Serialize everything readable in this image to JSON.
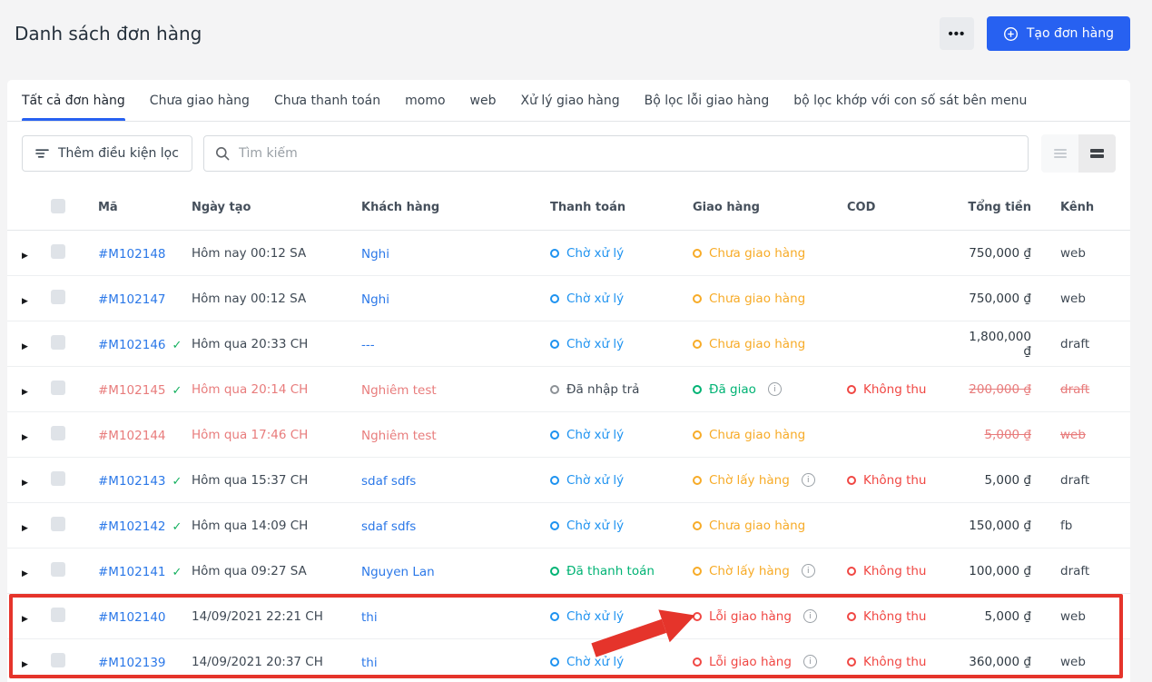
{
  "page": {
    "title": "Danh sách đơn hàng"
  },
  "actions": {
    "more_label": "•••",
    "create_label": "Tạo đơn hàng"
  },
  "tabs": [
    {
      "label": "Tất cả đơn hàng",
      "active": true
    },
    {
      "label": "Chưa giao hàng",
      "active": false
    },
    {
      "label": "Chưa thanh toán",
      "active": false
    },
    {
      "label": "momo",
      "active": false
    },
    {
      "label": "web",
      "active": false
    },
    {
      "label": "Xử lý giao hàng",
      "active": false
    },
    {
      "label": "Bộ lọc lỗi giao hàng",
      "active": false
    },
    {
      "label": "bộ lọc khớp với con số sát bên menu",
      "active": false
    }
  ],
  "filter": {
    "add_filter_label": "Thêm điều kiện lọc",
    "search_placeholder": "Tìm kiếm"
  },
  "table": {
    "columns": [
      "Mã",
      "Ngày tạo",
      "Khách hàng",
      "Thanh toán",
      "Giao hàng",
      "COD",
      "Tổng tiền",
      "Kênh"
    ],
    "currency": "₫",
    "rows": [
      {
        "code": "#M102148",
        "verified": false,
        "created": "Hôm nay 00:12 SA",
        "customer": "Nghi",
        "payment": {
          "label": "Chờ xử lý",
          "color": "blue"
        },
        "shipping": {
          "label": "Chưa giao hàng",
          "color": "orange",
          "info": false
        },
        "cod": null,
        "total": "750,000",
        "channel": "web",
        "muted": false,
        "total_struck": false,
        "channel_struck": false,
        "highlighted": false
      },
      {
        "code": "#M102147",
        "verified": false,
        "created": "Hôm nay 00:12 SA",
        "customer": "Nghi",
        "payment": {
          "label": "Chờ xử lý",
          "color": "blue"
        },
        "shipping": {
          "label": "Chưa giao hàng",
          "color": "orange",
          "info": false
        },
        "cod": null,
        "total": "750,000",
        "channel": "web",
        "muted": false,
        "total_struck": false,
        "channel_struck": false,
        "highlighted": false
      },
      {
        "code": "#M102146",
        "verified": true,
        "created": "Hôm qua 20:33 CH",
        "customer": "---",
        "payment": {
          "label": "Chờ xử lý",
          "color": "blue"
        },
        "shipping": {
          "label": "Chưa giao hàng",
          "color": "orange",
          "info": false
        },
        "cod": null,
        "total": "1,800,000",
        "channel": "draft",
        "muted": false,
        "total_struck": false,
        "channel_struck": false,
        "highlighted": false
      },
      {
        "code": "#M102145",
        "verified": true,
        "created": "Hôm qua 20:14 CH",
        "customer": "Nghiêm test",
        "payment": {
          "label": "Đã nhập trả",
          "color": "gray"
        },
        "shipping": {
          "label": "Đã giao",
          "color": "green",
          "info": true
        },
        "cod": {
          "label": "Không thu",
          "color": "red"
        },
        "total": "200,000",
        "channel": "draft",
        "muted": true,
        "total_struck": true,
        "channel_struck": true,
        "highlighted": false
      },
      {
        "code": "#M102144",
        "verified": false,
        "created": "Hôm qua 17:46 CH",
        "customer": "Nghiêm test",
        "payment": {
          "label": "Chờ xử lý",
          "color": "blue"
        },
        "shipping": {
          "label": "Chưa giao hàng",
          "color": "orange",
          "info": false
        },
        "cod": null,
        "total": "5,000",
        "channel": "web",
        "muted": true,
        "total_struck": true,
        "channel_struck": true,
        "highlighted": false
      },
      {
        "code": "#M102143",
        "verified": true,
        "created": "Hôm qua 15:37 CH",
        "customer": "sdaf sdfs",
        "payment": {
          "label": "Chờ xử lý",
          "color": "blue"
        },
        "shipping": {
          "label": "Chờ lấy hàng",
          "color": "orange",
          "info": true
        },
        "cod": {
          "label": "Không thu",
          "color": "red"
        },
        "total": "5,000",
        "channel": "draft",
        "muted": false,
        "total_struck": false,
        "channel_struck": false,
        "highlighted": false
      },
      {
        "code": "#M102142",
        "verified": true,
        "created": "Hôm qua 14:09 CH",
        "customer": "sdaf sdfs",
        "payment": {
          "label": "Chờ xử lý",
          "color": "blue"
        },
        "shipping": {
          "label": "Chưa giao hàng",
          "color": "orange",
          "info": false
        },
        "cod": null,
        "total": "150,000",
        "channel": "fb",
        "muted": false,
        "total_struck": false,
        "channel_struck": false,
        "highlighted": false
      },
      {
        "code": "#M102141",
        "verified": true,
        "created": "Hôm qua 09:27 SA",
        "customer": "Nguyen Lan",
        "payment": {
          "label": "Đã thanh toán",
          "color": "green"
        },
        "shipping": {
          "label": "Chờ lấy hàng",
          "color": "orange",
          "info": true
        },
        "cod": {
          "label": "Không thu",
          "color": "red"
        },
        "total": "100,000",
        "channel": "draft",
        "muted": false,
        "total_struck": false,
        "channel_struck": false,
        "highlighted": false
      },
      {
        "code": "#M102140",
        "verified": false,
        "created": "14/09/2021 22:21 CH",
        "customer": "thi",
        "payment": {
          "label": "Chờ xử lý",
          "color": "blue"
        },
        "shipping": {
          "label": "Lỗi giao hàng",
          "color": "red",
          "info": true
        },
        "cod": {
          "label": "Không thu",
          "color": "red"
        },
        "total": "5,000",
        "channel": "web",
        "muted": false,
        "total_struck": false,
        "channel_struck": false,
        "highlighted": true
      },
      {
        "code": "#M102139",
        "verified": false,
        "created": "14/09/2021 20:37 CH",
        "customer": "thi",
        "payment": {
          "label": "Chờ xử lý",
          "color": "blue"
        },
        "shipping": {
          "label": "Lỗi giao hàng",
          "color": "red",
          "info": true
        },
        "cod": {
          "label": "Không thu",
          "color": "red"
        },
        "total": "360,000",
        "channel": "web",
        "muted": false,
        "total_struck": false,
        "channel_struck": false,
        "highlighted": true
      }
    ]
  },
  "colors": {
    "accent_blue": "#2761f1",
    "status_blue": "#1d92f0",
    "status_orange": "#f7ab27",
    "status_green": "#00b374",
    "status_red": "#f04743",
    "muted_red": "#e87c7c",
    "annotation_red": "#e5342b"
  }
}
